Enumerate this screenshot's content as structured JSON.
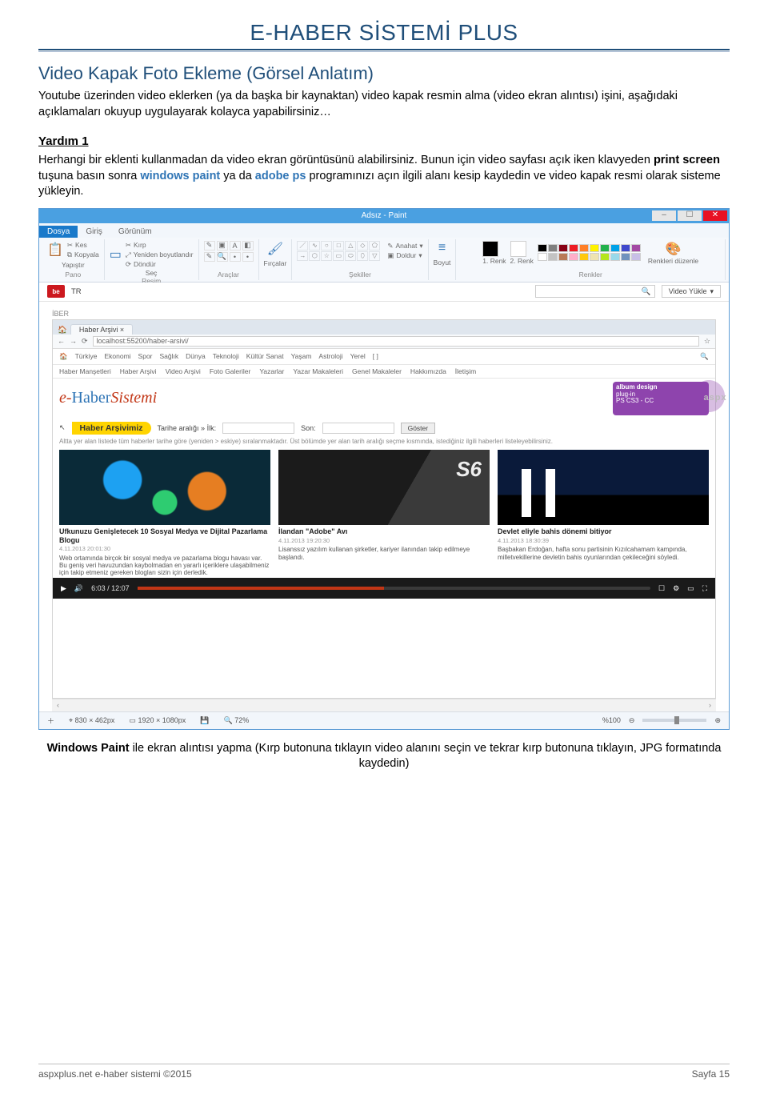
{
  "doc": {
    "title": "E-HABER SİSTEMİ PLUS",
    "section_title": "Video Kapak Foto Ekleme (Görsel Anlatım)",
    "intro": "Youtube üzerinden video eklerken (ya da başka bir kaynaktan) video kapak resmin alma (video ekran alıntısı) işini, aşağıdaki açıklamaları okuyup uygulayarak kolayca yapabilirsiniz…",
    "yardim_heading": "Yardım 1",
    "help_pre": "Herhangi bir eklenti kullanmadan da video ekran görüntüsünü alabilirsiniz. Bunun için video sayfası açık iken klavyeden ",
    "help_b1": "print screen",
    "help_mid1": " tuşuna basın sonra ",
    "help_blue1": "windows paint",
    "help_mid2": " ya da ",
    "help_blue2": "adobe ps",
    "help_post": " programınızı açın ilgili alanı kesip kaydedin ve video kapak resmi olarak sisteme yükleyin.",
    "caption_b": "Windows Paint",
    "caption_rest": " ile ekran alıntısı yapma (Kırp butonuna tıklayın video alanını seçin ve tekrar kırp butonuna tıklayın,  JPG formatında kaydedin)"
  },
  "paint": {
    "title": "Adsız - Paint",
    "tabs": {
      "file": "Dosya",
      "home": "Giriş",
      "view": "Görünüm"
    },
    "pano": {
      "paste": "Yapıştır",
      "cut": "Kes",
      "copy": "Kopyala",
      "group": "Pano"
    },
    "resim": {
      "select": "Seç",
      "crop": "Kırp",
      "resize": "Yeniden boyutlandır",
      "rotate": "Döndür",
      "group": "Resim"
    },
    "tools_group": "Araçlar",
    "brush": "Fırçalar",
    "shapes": {
      "group": "Şekiller",
      "outline": "Anahat",
      "fill": "Doldur"
    },
    "size": "Boyut",
    "colors": {
      "c1": "1. Renk",
      "c2": "2. Renk",
      "group": "Renkler",
      "edit": "Renkleri düzenle"
    }
  },
  "yt": {
    "badge": "be",
    "tr": "TR",
    "search_icon": "🔍",
    "upload": "Video Yükle"
  },
  "browser": {
    "tab": "Haber Arşivi",
    "url": "localhost:55200/haber-arsivi/",
    "siteNav": [
      "Türkiye",
      "Ekonomi",
      "Spor",
      "Sağlık",
      "Dünya",
      "Teknoloji",
      "Kültür Sanat",
      "Yaşam",
      "Astroloji",
      "Yerel",
      "[ ]"
    ],
    "subNav": [
      "Haber Manşetleri",
      "Haber Arşivi",
      "Video Arşivi",
      "Foto Galeriler",
      "Yazarlar",
      "Yazar Makaleleri",
      "Genel Makaleler",
      "Hakkımızda",
      "İletişim"
    ],
    "brand_e": "e-",
    "brand_haber": "Haber",
    "brand_sistemi": "Sistemi",
    "ad1": "album design",
    "ad2": "plug-in",
    "ad3": "PS CS3 - CC",
    "pill": "Haber Arşivimiz",
    "f_start": "Tarihe aralığı » İlk:",
    "f_end": "Son:",
    "f_go": "Göster",
    "hint": "Altta yer alan listede tüm haberler tarihe göre (yeniden > eskiye) sıralanmaktadır. Üst bölümde yer alan tarih aralığı seçme kısmında, istediğiniz ilgili haberleri listeleyebilirsiniz.",
    "watermark": "aspx PLUS"
  },
  "cards": [
    {
      "title": "Ufkunuzu Genişletecek 10 Sosyal Medya ve Dijital Pazarlama Blogu",
      "meta": "4.11.2013 20:01:30",
      "desc": "Web ortamında birçok bir sosyal medya ve pazarlama blogu havası var. Bu geniş veri havuzundan kaybolmadan en yararlı içeriklere ulaşabilmeniz için takip etmeniz gereken blogları sizin için derledik."
    },
    {
      "title": "İlandan \"Adobe\" Avı",
      "meta": "4.11.2013 19:20:30",
      "desc": "Lisanssız yazılım kullanan şirketler, kariyer ilanından takip edilmeye başlandı."
    },
    {
      "title": "Devlet eliyle bahis dönemi bitiyor",
      "meta": "4.11.2013 18:30:39",
      "desc": "Başbakan Erdoğan, hafta sonu partisinin Kızılcahamam kampında, milletvekillerine devletin bahis oyunlarından çekileceğini söyledi."
    }
  ],
  "video": {
    "time": "6:03 / 12:07"
  },
  "status": {
    "cursor": "830 × 462px",
    "canvas": "1920 × 1080px",
    "zoom_lbl": "72%",
    "zoom_right": "%100"
  },
  "footer": {
    "left": "aspxplus.net e-haber sistemi ©2015",
    "right": "Sayfa 15"
  }
}
